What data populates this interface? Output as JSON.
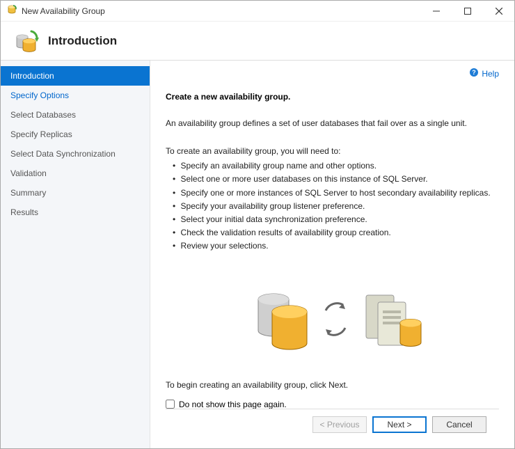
{
  "window": {
    "title": "New Availability Group"
  },
  "header": {
    "page_title": "Introduction"
  },
  "sidebar": {
    "items": [
      {
        "label": "Introduction",
        "state": "active"
      },
      {
        "label": "Specify Options",
        "state": "link"
      },
      {
        "label": "Select Databases",
        "state": ""
      },
      {
        "label": "Specify Replicas",
        "state": ""
      },
      {
        "label": "Select Data Synchronization",
        "state": ""
      },
      {
        "label": "Validation",
        "state": ""
      },
      {
        "label": "Summary",
        "state": ""
      },
      {
        "label": "Results",
        "state": ""
      }
    ]
  },
  "main": {
    "help_label": "Help",
    "heading": "Create a new availability group.",
    "intro": "An availability group defines a set of user databases that fail over as a single unit.",
    "need_intro": "To create an availability group, you will need to:",
    "need_items": [
      "Specify an availability group name and other options.",
      "Select one or more user databases on this instance of SQL Server.",
      "Specify one or more instances of SQL Server to host secondary availability replicas.",
      "Specify your availability group listener preference.",
      "Select your initial data synchronization preference.",
      "Check the validation results of availability group creation.",
      "Review your selections."
    ],
    "begin_text": "To begin creating an availability group, click Next.",
    "checkbox_label": "Do not show this page again."
  },
  "footer": {
    "previous_label": "< Previous",
    "next_label": "Next >",
    "cancel_label": "Cancel"
  }
}
